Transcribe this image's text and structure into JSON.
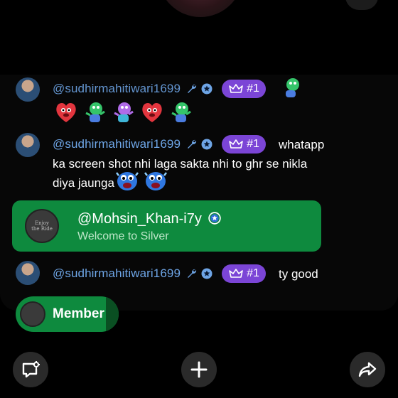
{
  "messages": [
    {
      "username": "@sudhirmahitiwari1699",
      "rank": "#1",
      "text": "",
      "stickers": [
        "red-heart-character-sticker",
        "green-dancing-character-sticker",
        "purple-dancing-character-sticker",
        "red-heart-character-sticker",
        "green-dancing-character-sticker"
      ]
    },
    {
      "username": "@sudhirmahitiwari1699",
      "rank": "#1",
      "text_line1": "whatapp",
      "text_line2": "ka screen shot nhi laga sakta nhi to ghr se nikla",
      "text_line3": "diya jaunga",
      "stickers": [
        "blue-crying-character-sticker",
        "blue-crying-character-sticker"
      ]
    },
    {
      "username": "@sudhirmahitiwari1699",
      "rank": "#1",
      "text": "ty good"
    }
  ],
  "join_card": {
    "name": "@Mohsin_Khan-i7y",
    "subtitle": "Welcome to Silver",
    "avatar_text": "Enjoy the Ride"
  },
  "member_button": {
    "label": "Member"
  },
  "toolbar": {
    "icons": [
      "chat-settings-icon",
      "plus-icon",
      "share-icon"
    ]
  },
  "colors": {
    "background": "#000000",
    "username": "#6ea5e6",
    "rank_badge": "#7b45d6",
    "join_card": "#0e8a3e",
    "button_bg": "#2a2a2a"
  }
}
